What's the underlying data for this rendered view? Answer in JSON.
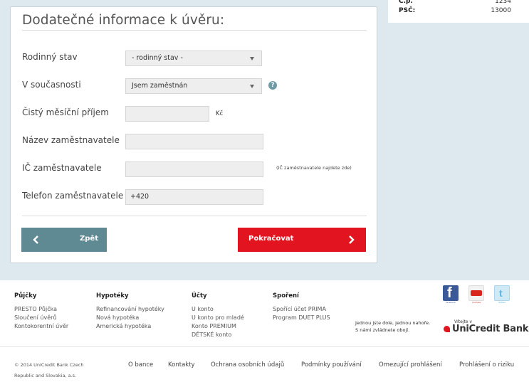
{
  "summary_card": {
    "cp_label": "Č.p.",
    "cp_value": "1234",
    "psc_label": "PSČ:",
    "psc_value": "13000"
  },
  "form": {
    "title": "Dodatečné informace k úvěru:",
    "marital_status": {
      "label": "Rodinný stav",
      "value": "- rodinný stav -"
    },
    "employment": {
      "label": "V současnosti",
      "value": "Jsem zaměstnán",
      "help_glyph": "?"
    },
    "income": {
      "label": "Čistý měsíční příjem",
      "value": "",
      "unit": "Kč"
    },
    "employer_name": {
      "label": "Název zaměstnavatele",
      "value": ""
    },
    "employer_ic": {
      "label": "IČ zaměstnavatele",
      "value": "",
      "hint": "(IČ zaměstnavatele najdete zde)"
    },
    "employer_phone": {
      "label": "Telefon zaměstnavatele",
      "value": "+420"
    },
    "back_label": "Zpět",
    "next_label": "Pokračovat"
  },
  "footer": {
    "columns": [
      {
        "heading": "Půjčky",
        "items": [
          "PRESTO Půjčka",
          "Sloučení úvěrů",
          "Kontokorentní úvěr"
        ]
      },
      {
        "heading": "Hypotéky",
        "items": [
          "Refinancování hypotéky",
          "Nová hypotéka",
          "Americká hypotéka"
        ]
      },
      {
        "heading": "Účty",
        "items": [
          "U konto",
          "U konto pro mladé",
          "Konto PREMIUM",
          "DĚTSKÉ konto"
        ]
      },
      {
        "heading": "Spoření",
        "items": [
          "Spořící účet PRIMA",
          "Program DUET PLUS"
        ]
      }
    ],
    "social": [
      {
        "name": "facebook-icon",
        "caption": "facebook"
      },
      {
        "name": "youtube-icon",
        "caption": "YouTube"
      },
      {
        "name": "twitter-icon",
        "caption": "Twitter"
      }
    ],
    "tagline_1": "Jednou jste dole, jednou nahoře.",
    "tagline_2": "S námi zvládnete obojí.",
    "brand_small": "Vítejte v",
    "brand": "UniCredit Bank",
    "copyright_1": "© 2014 UniCredit Bank Czech",
    "copyright_2": "Republic and Slovakia, a.s.",
    "links": [
      "O bance",
      "Kontakty",
      "Ochrana osobních údajů",
      "Podmínky používání",
      "Omezující prohlášení",
      "Prohlášení o riziku"
    ]
  },
  "colors": {
    "accent_red": "#e2141f",
    "back_button": "#608a93",
    "page_background": "#dde9ee"
  }
}
